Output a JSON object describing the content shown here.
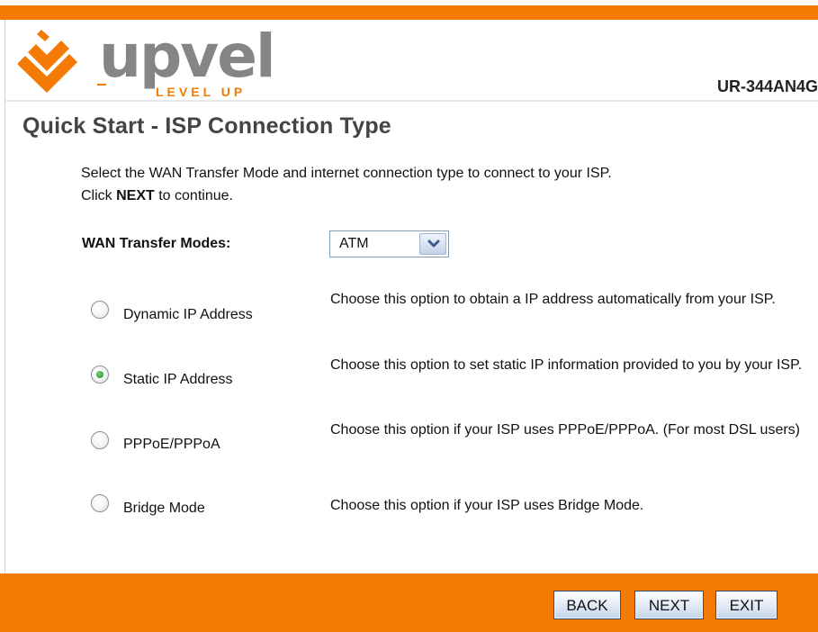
{
  "brand": {
    "logo_text": "upvel",
    "tagline": "LEVEL UP",
    "model": "UR-344AN4G",
    "colors": {
      "orange": "#f37a05",
      "logo_gray": "#858585",
      "title_gray": "#444444"
    }
  },
  "page": {
    "title": "Quick Start - ISP Connection Type",
    "intro_line1": "Select the WAN Transfer Mode and internet connection type to connect to your ISP.",
    "intro_click": "Click ",
    "intro_next": "NEXT",
    "intro_rest": " to continue."
  },
  "wan": {
    "label": "WAN Transfer Modes:",
    "selected": "ATM"
  },
  "options": [
    {
      "label": "Dynamic IP Address",
      "desc": "Choose this option to obtain a IP address automatically from your ISP.",
      "checked": false
    },
    {
      "label": "Static IP Address",
      "desc": "Choose this option to set static IP information provided to you by your ISP.",
      "checked": true
    },
    {
      "label": "PPPoE/PPPoA",
      "desc": "Choose this option if your ISP uses PPPoE/PPPoA. (For most DSL users)",
      "checked": false
    },
    {
      "label": "Bridge Mode",
      "desc": "Choose this option if your ISP uses Bridge Mode.",
      "checked": false
    }
  ],
  "buttons": {
    "back": "BACK",
    "next": "NEXT",
    "exit": "EXIT"
  }
}
